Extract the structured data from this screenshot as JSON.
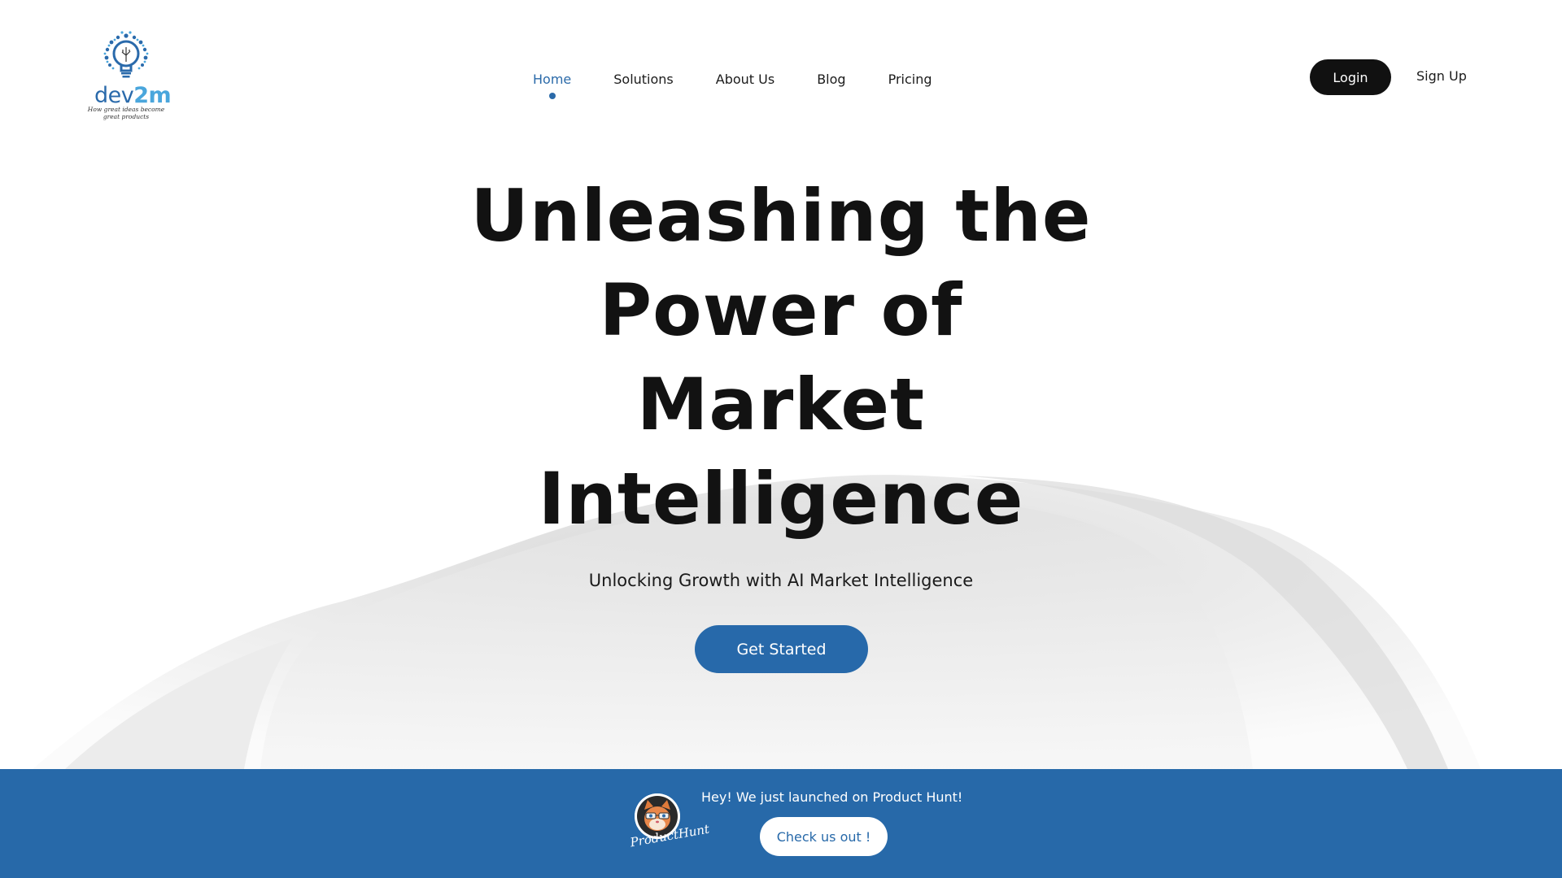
{
  "logo": {
    "word_prefix": "dev",
    "word_suffix": "2m",
    "tagline": "How great ideas become great products",
    "alt_icon": "lightbulb-gear-icon"
  },
  "nav": {
    "items": [
      {
        "label": "Home",
        "active": true
      },
      {
        "label": "Solutions",
        "active": false
      },
      {
        "label": "About Us",
        "active": false
      },
      {
        "label": "Blog",
        "active": false
      },
      {
        "label": "Pricing",
        "active": false
      }
    ]
  },
  "auth": {
    "login_label": "Login",
    "signup_label": "Sign Up"
  },
  "hero": {
    "title": "Unleashing the Power of Market Intelligence",
    "subtitle": "Unlocking Growth with AI Market Intelligence",
    "cta_label": "Get Started"
  },
  "product_hunt": {
    "message": "Hey! We just launched on Product Hunt!",
    "button_label": "Check us out !",
    "signature": "ProductHunt"
  },
  "colors": {
    "brand_blue": "#2769a9",
    "text_dark": "#121212",
    "login_bg": "#111111"
  }
}
